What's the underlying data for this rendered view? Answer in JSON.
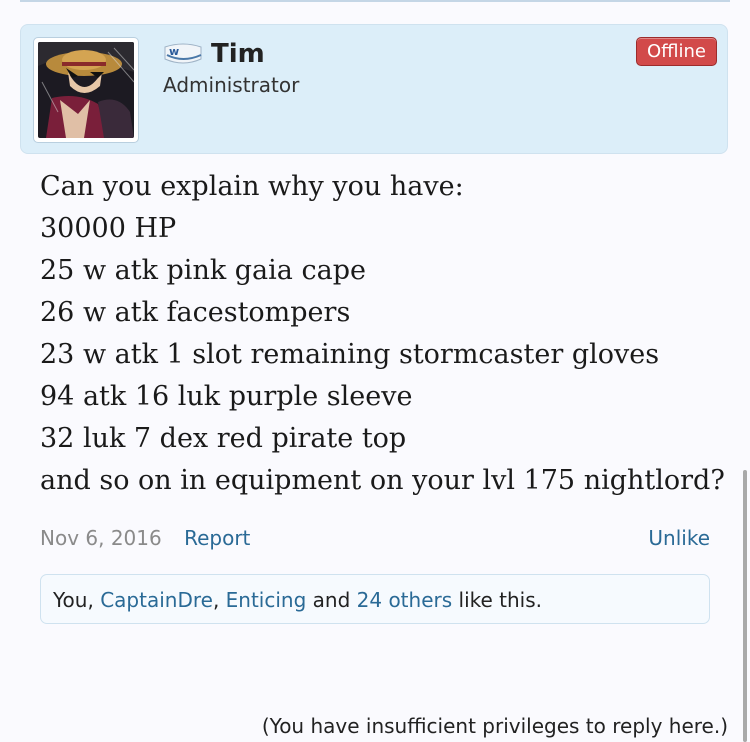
{
  "user": {
    "name": "Tim",
    "title": "Administrator",
    "status": "Offline",
    "rank_icon_text": "w"
  },
  "post": {
    "lines": [
      "Can you explain why you have:",
      "30000 HP",
      "25 w atk pink gaia cape",
      "26 w atk facestompers",
      "23 w atk 1 slot remaining stormcaster gloves",
      "94 atk 16 luk purple sleeve",
      "32 luk 7 dex red pirate top",
      "and so on in equipment on your lvl 175 nightlord?"
    ],
    "date": "Nov 6, 2016",
    "report_label": "Report",
    "unlike_label": "Unlike"
  },
  "likes": {
    "you": "You",
    "sep1": ", ",
    "user1": "CaptainDre",
    "sep2": ", ",
    "user2": "Enticing",
    "and": " and ",
    "others": "24 others",
    "suffix": " like this."
  },
  "footer": {
    "note": "(You have insufficient privileges to reply here.)"
  },
  "colors": {
    "card_bg": "#dceef9",
    "link": "#2a6a96",
    "offline_badge": "#d24a4a"
  }
}
